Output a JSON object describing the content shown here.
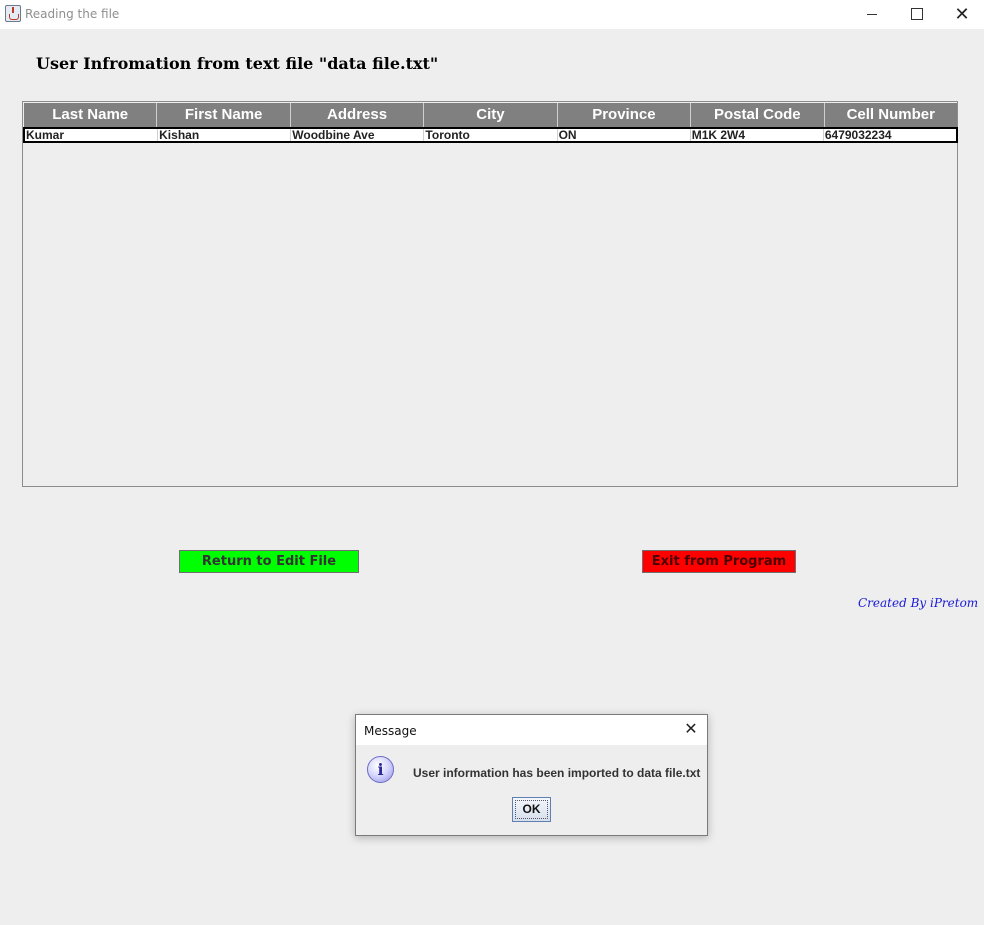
{
  "window": {
    "title": "Reading the file",
    "close_glyph": "✕"
  },
  "page": {
    "heading": "User Infromation from text file \"data file.txt\""
  },
  "table": {
    "columns": [
      "Last Name",
      "First Name",
      "Address",
      "City",
      "Province",
      "Postal Code",
      "Cell Number"
    ],
    "rows": [
      [
        "Kumar",
        "Kishan",
        "Woodbine Ave",
        "Toronto",
        "ON",
        "M1K 2W4",
        "6479032234"
      ]
    ]
  },
  "buttons": {
    "return_label": "Return to Edit File",
    "exit_label": "Exit from Program",
    "return_color": "#00ff00",
    "exit_color": "#ff0000"
  },
  "credit": "Created By iPretom",
  "dialog": {
    "title": "Message",
    "close_glyph": "✕",
    "icon": "info-icon",
    "icon_glyph": "i",
    "message": "User information has been imported to data file.txt",
    "ok_label": "OK"
  }
}
